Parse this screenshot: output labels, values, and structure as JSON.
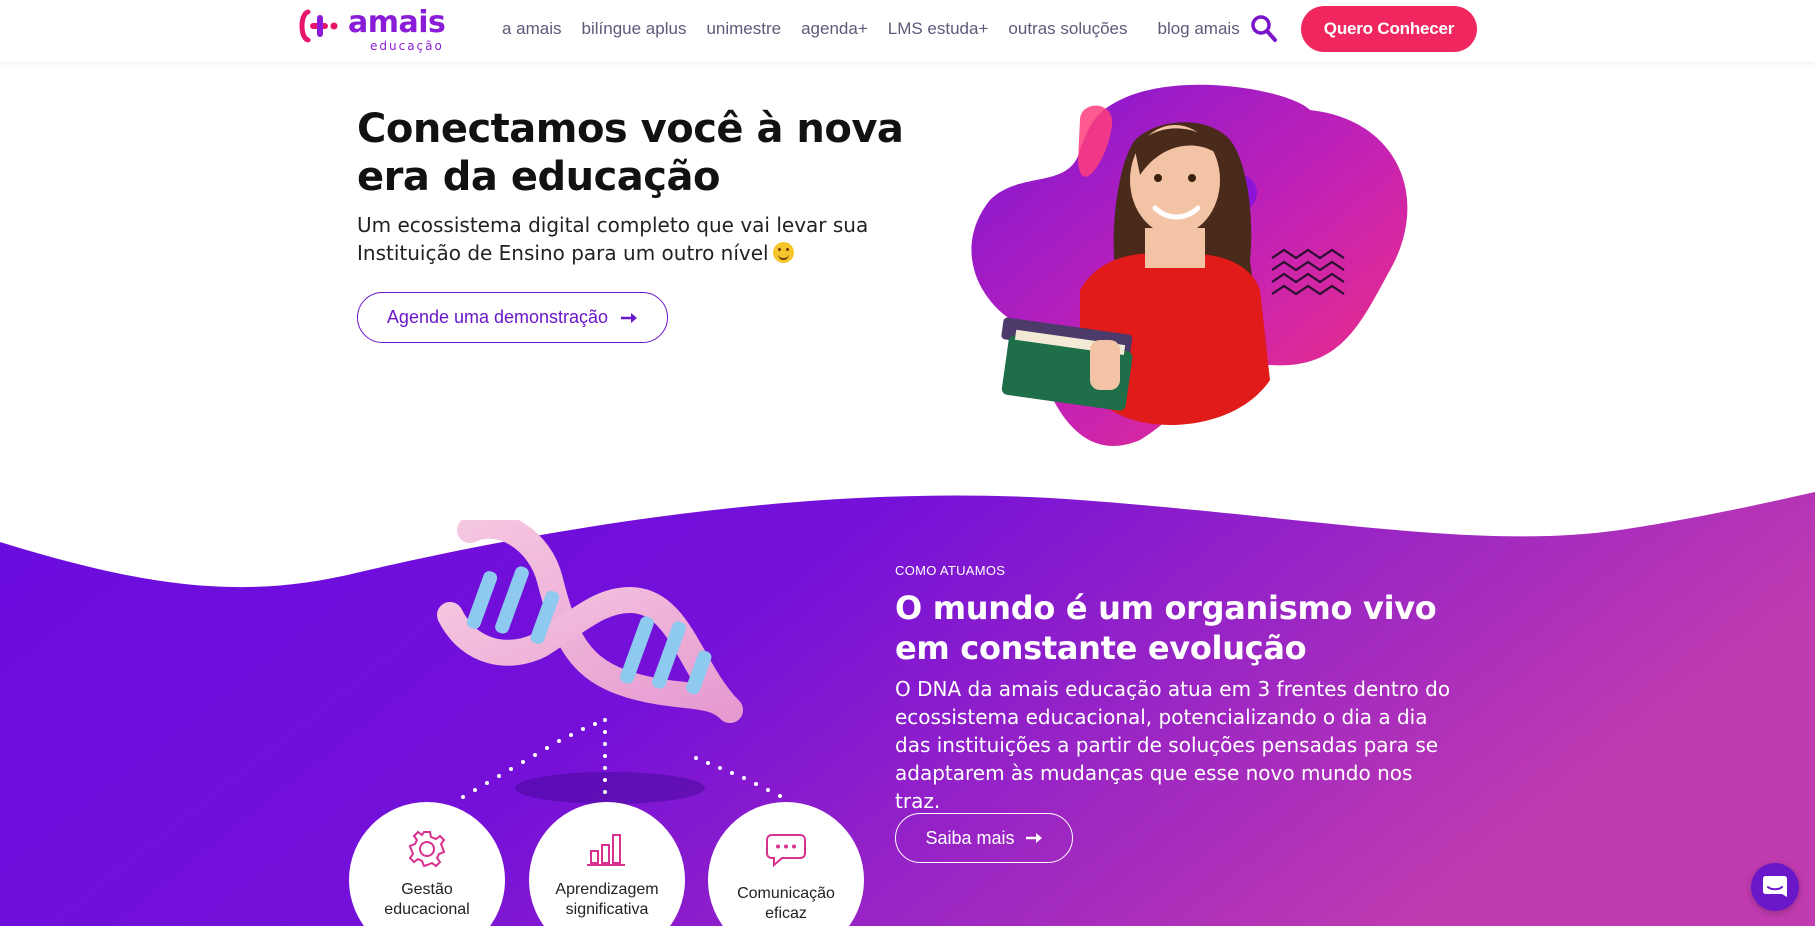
{
  "logo": {
    "word": "amais",
    "sub": "educação"
  },
  "nav": {
    "items": [
      "a amais",
      "bilíngue aplus",
      "unimestre",
      "agenda+",
      "LMS estuda+",
      "outras soluções",
      "blog amais"
    ],
    "cta": "Quero Conhecer"
  },
  "hero": {
    "title": "Conectamos você à nova era da educação",
    "subtitle": "Um ecossistema digital completo que vai levar sua Instituição de Ensino para um outro nível",
    "button": "Agende uma demonstração"
  },
  "section": {
    "eyebrow": "COMO ATUAMOS",
    "title": "O mundo é um organismo vivo em constante evolução",
    "body": "O DNA da amais educação atua em 3 frentes dentro do ecossistema educacional, potencializando o dia a dia das instituições a partir de soluções pensadas para se adaptarem às mudanças que esse novo mundo nos traz.",
    "button": "Saiba mais",
    "pillars": [
      {
        "line1": "Gestão",
        "line2": "educacional"
      },
      {
        "line1": "Aprendizagem",
        "line2": "significativa"
      },
      {
        "line1": "Comunicação",
        "line2": "eficaz"
      }
    ]
  },
  "icons": {
    "search": "search-icon",
    "arrow": "arrow-right-icon",
    "gear": "gear-icon",
    "chart": "bar-chart-icon",
    "chat": "chat-bubble-icon",
    "support": "chat-support-icon"
  },
  "colors": {
    "brand_purple": "#8a1bd6",
    "cta_pink": "#f0275f",
    "button_purple": "#6a17c9",
    "section_gradient_start": "#6a0ce0",
    "section_gradient_end": "#c13bb0"
  }
}
